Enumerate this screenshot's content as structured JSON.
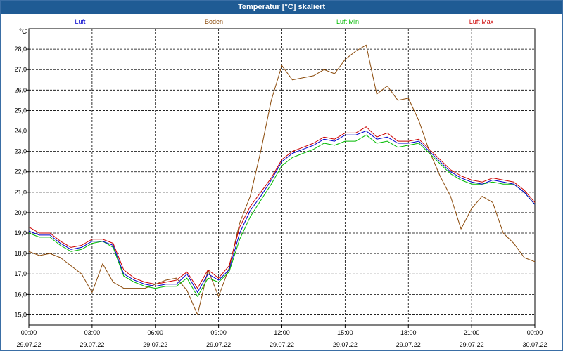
{
  "window": {
    "title": "Temperatur [°C] skaliert"
  },
  "colors": {
    "titlebar": "#1f5b94",
    "luft": "#0000cc",
    "boden": "#8b4a0a",
    "luft_min": "#00bb00",
    "luft_max": "#cc0000"
  },
  "chart_data": {
    "type": "line",
    "title": "Temperatur [°C] skaliert",
    "ylabel": "°C",
    "ylim": [
      14.5,
      29.0
    ],
    "xlim": [
      "29.07.22 00:00",
      "30.07.22 00:00"
    ],
    "grid": true,
    "legend_position": "top",
    "yticks": [
      "15,0",
      "16,0",
      "17,0",
      "18,0",
      "19,0",
      "20,0",
      "21,0",
      "22,0",
      "23,0",
      "24,0",
      "25,0",
      "26,0",
      "27,0",
      "28,0"
    ],
    "ytick_values": [
      15,
      16,
      17,
      18,
      19,
      20,
      21,
      22,
      23,
      24,
      25,
      26,
      27,
      28
    ],
    "xticks": [
      {
        "time": "00:00",
        "date": "29.07.22"
      },
      {
        "time": "03:00",
        "date": "29.07.22"
      },
      {
        "time": "06:00",
        "date": "29.07.22"
      },
      {
        "time": "09:00",
        "date": "29.07.22"
      },
      {
        "time": "12:00",
        "date": "29.07.22"
      },
      {
        "time": "15:00",
        "date": "29.07.22"
      },
      {
        "time": "18:00",
        "date": "29.07.22"
      },
      {
        "time": "21:00",
        "date": "29.07.22"
      },
      {
        "time": "00:00",
        "date": "30.07.22"
      }
    ],
    "x": [
      "00:00",
      "00:30",
      "01:00",
      "01:30",
      "02:00",
      "02:30",
      "03:00",
      "03:30",
      "04:00",
      "04:30",
      "05:00",
      "05:30",
      "06:00",
      "06:30",
      "07:00",
      "07:30",
      "08:00",
      "08:30",
      "09:00",
      "09:30",
      "10:00",
      "10:30",
      "11:00",
      "11:30",
      "12:00",
      "12:30",
      "13:00",
      "13:30",
      "14:00",
      "14:30",
      "15:00",
      "15:30",
      "16:00",
      "16:30",
      "17:00",
      "17:30",
      "18:00",
      "18:30",
      "19:00",
      "19:30",
      "20:00",
      "20:30",
      "21:00",
      "21:30",
      "22:00",
      "22:30",
      "23:00",
      "23:30",
      "24:00"
    ],
    "series": [
      {
        "name": "Luft",
        "color": "#0000cc",
        "values": [
          19.1,
          18.9,
          18.9,
          18.5,
          18.2,
          18.3,
          18.6,
          18.6,
          18.4,
          17.0,
          16.7,
          16.5,
          16.4,
          16.5,
          16.5,
          17.0,
          16.1,
          17.0,
          16.7,
          17.2,
          19.0,
          20.1,
          20.8,
          21.6,
          22.5,
          22.9,
          23.1,
          23.3,
          23.6,
          23.5,
          23.8,
          23.8,
          24.0,
          23.6,
          23.7,
          23.4,
          23.4,
          23.5,
          23.0,
          22.5,
          22.0,
          21.7,
          21.5,
          21.4,
          21.6,
          21.5,
          21.4,
          21.0,
          20.4
        ]
      },
      {
        "name": "Boden",
        "color": "#8b4a0a",
        "values": [
          18.1,
          17.9,
          18.0,
          17.8,
          17.4,
          17.0,
          16.1,
          17.5,
          16.6,
          16.3,
          16.3,
          16.3,
          16.5,
          16.7,
          16.8,
          16.2,
          15.0,
          17.2,
          15.9,
          17.3,
          19.5,
          20.8,
          23.0,
          25.5,
          27.2,
          26.5,
          26.6,
          26.7,
          27.0,
          26.8,
          27.5,
          27.9,
          28.2,
          25.8,
          26.2,
          25.5,
          25.6,
          24.5,
          23.0,
          21.8,
          20.8,
          19.2,
          20.2,
          20.8,
          20.5,
          19.0,
          18.5,
          17.8,
          17.6
        ]
      },
      {
        "name": "Luft Min",
        "color": "#00bb00",
        "values": [
          19.0,
          18.8,
          18.8,
          18.4,
          18.1,
          18.2,
          18.5,
          18.6,
          18.3,
          16.9,
          16.6,
          16.4,
          16.3,
          16.4,
          16.4,
          16.8,
          15.9,
          16.8,
          16.6,
          17.1,
          18.7,
          19.8,
          20.6,
          21.4,
          22.3,
          22.7,
          22.9,
          23.1,
          23.4,
          23.3,
          23.5,
          23.5,
          23.8,
          23.4,
          23.5,
          23.2,
          23.3,
          23.4,
          22.9,
          22.4,
          21.9,
          21.6,
          21.4,
          21.4,
          21.5,
          21.4,
          21.4,
          21.0,
          20.4
        ]
      },
      {
        "name": "Luft Max",
        "color": "#cc0000",
        "values": [
          19.3,
          19.0,
          19.0,
          18.6,
          18.3,
          18.4,
          18.7,
          18.7,
          18.5,
          17.2,
          16.8,
          16.6,
          16.5,
          16.6,
          16.7,
          17.1,
          16.3,
          17.2,
          16.8,
          17.4,
          19.3,
          20.3,
          21.0,
          21.7,
          22.6,
          23.0,
          23.2,
          23.4,
          23.7,
          23.6,
          23.9,
          23.9,
          24.2,
          23.7,
          23.9,
          23.5,
          23.5,
          23.6,
          23.1,
          22.6,
          22.1,
          21.8,
          21.6,
          21.5,
          21.7,
          21.6,
          21.5,
          21.1,
          20.5
        ]
      }
    ]
  }
}
